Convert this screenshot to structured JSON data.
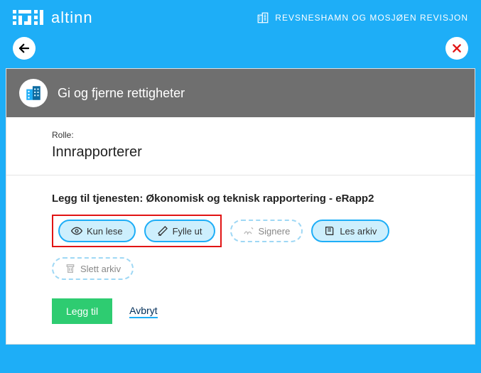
{
  "header": {
    "brand": "altinn",
    "org": "REVSNESHAMN OG MOSJØEN REVISJON"
  },
  "panel": {
    "title": "Gi og fjerne rettigheter",
    "role_label": "Rolle:",
    "role_value": "Innrapporterer",
    "section_title": "Legg til tjenesten: Økonomisk og teknisk rapportering - eRapp2",
    "pills": {
      "read": "Kun lese",
      "fill": "Fylle ut",
      "sign": "Signere",
      "read_archive": "Les arkiv",
      "delete_archive": "Slett arkiv"
    },
    "actions": {
      "add": "Legg til",
      "cancel": "Avbryt"
    }
  }
}
